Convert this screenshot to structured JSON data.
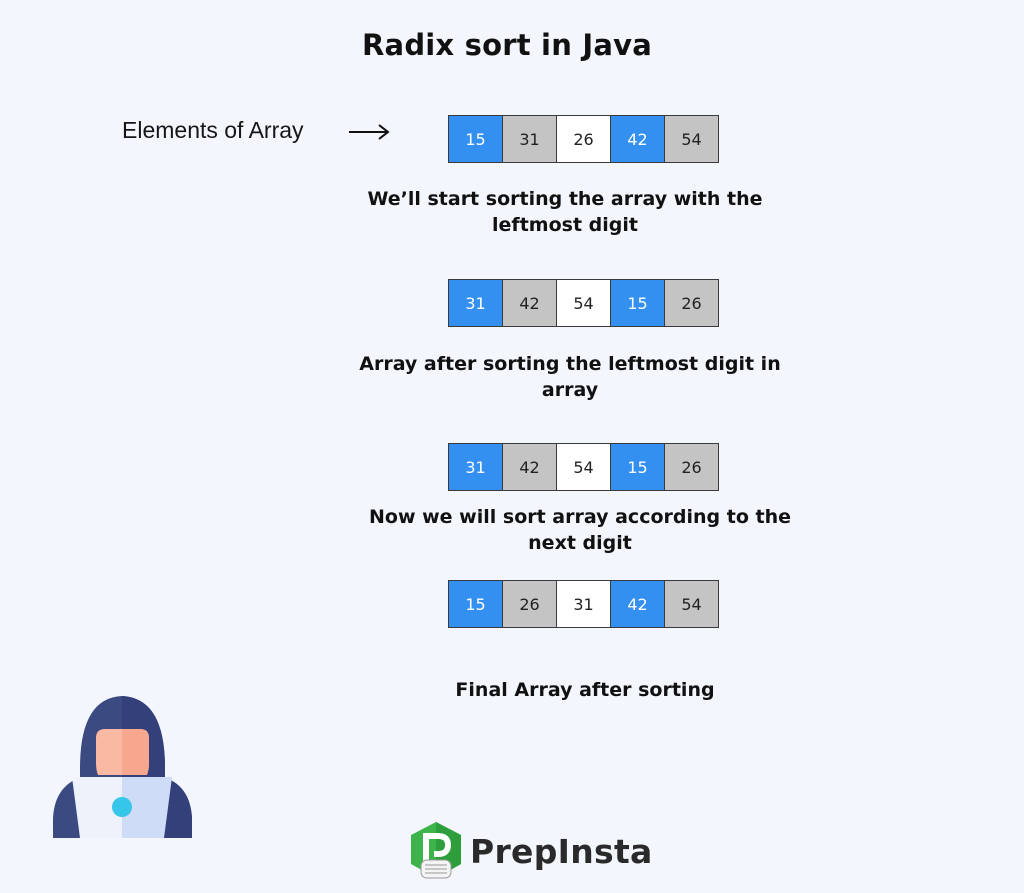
{
  "title": "Radix sort in Java",
  "elements_label": "Elements of Array",
  "arrays": [
    {
      "cells": [
        {
          "value": "15",
          "color": "blue"
        },
        {
          "value": "31",
          "color": "gray"
        },
        {
          "value": "26",
          "color": "white"
        },
        {
          "value": "42",
          "color": "blue"
        },
        {
          "value": "54",
          "color": "gray"
        }
      ]
    },
    {
      "cells": [
        {
          "value": "31",
          "color": "blue"
        },
        {
          "value": "42",
          "color": "gray"
        },
        {
          "value": "54",
          "color": "white"
        },
        {
          "value": "15",
          "color": "blue"
        },
        {
          "value": "26",
          "color": "gray"
        }
      ]
    },
    {
      "cells": [
        {
          "value": "31",
          "color": "blue"
        },
        {
          "value": "42",
          "color": "gray"
        },
        {
          "value": "54",
          "color": "white"
        },
        {
          "value": "15",
          "color": "blue"
        },
        {
          "value": "26",
          "color": "gray"
        }
      ]
    },
    {
      "cells": [
        {
          "value": "15",
          "color": "blue"
        },
        {
          "value": "26",
          "color": "gray"
        },
        {
          "value": "31",
          "color": "white"
        },
        {
          "value": "42",
          "color": "blue"
        },
        {
          "value": "54",
          "color": "gray"
        }
      ]
    }
  ],
  "captions": [
    {
      "line1": "We’ll start sorting the array with the",
      "line2": "leftmost digit"
    },
    {
      "line1": "Array after sorting the leftmost digit in",
      "line2": "array"
    },
    {
      "line1": "Now we will sort array according to the",
      "line2": "next digit"
    },
    {
      "line1": "Final Array after sorting",
      "line2": ""
    }
  ],
  "colors": {
    "blue": "#3490f0",
    "gray": "#c4c4c4",
    "white": "#ffffff",
    "background": "#f3f6fd",
    "logo_green": "#3cb44b"
  },
  "icons": {
    "arrow": "long-right-arrow",
    "avatar": "hooded-person-with-laptop",
    "logo": "prepinsta-hexagon-logo"
  },
  "logo": {
    "text": "PrepInsta"
  }
}
